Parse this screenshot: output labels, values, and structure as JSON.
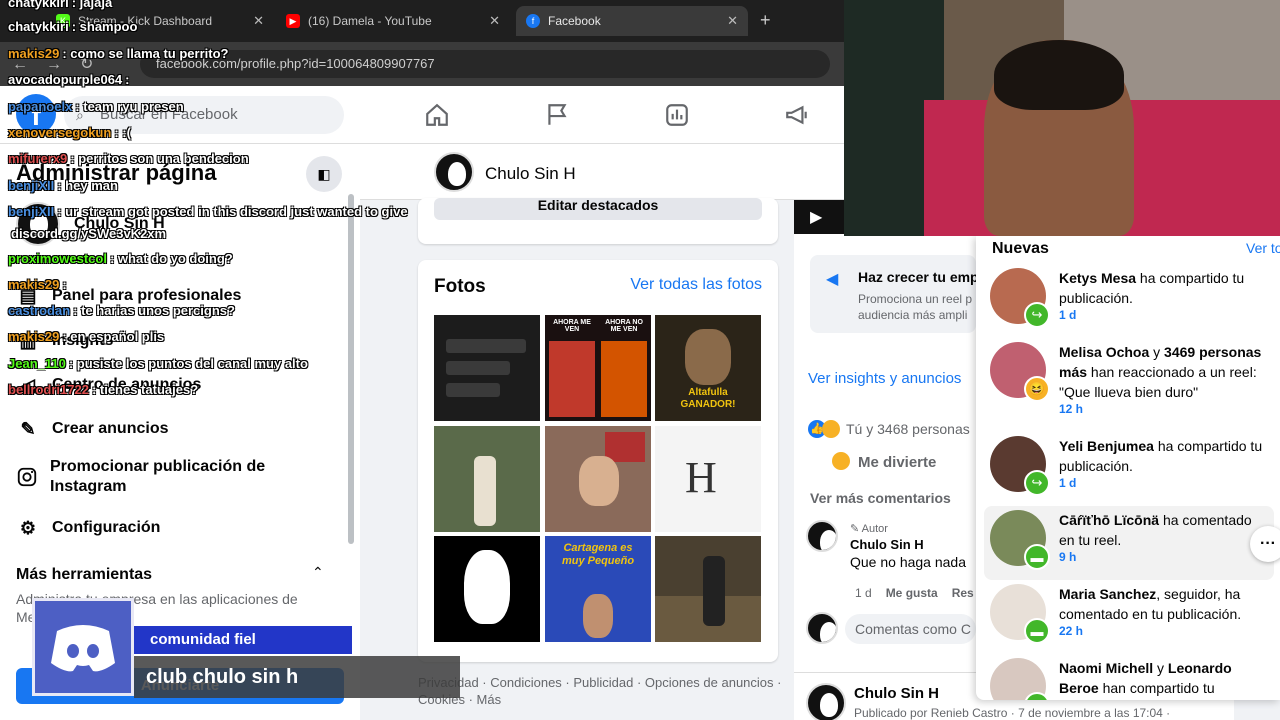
{
  "browser": {
    "tabs": [
      {
        "label": "Stream - Kick Dashboard",
        "color": "#53fc18"
      },
      {
        "label": "(16) Damela - YouTube",
        "color": "#ff0000"
      },
      {
        "label": "Facebook",
        "color": "#1877f2"
      }
    ],
    "url": "facebook.com/profile.php?id=100064809907767"
  },
  "fb_header": {
    "search_placeholder": "Buscar en Facebook",
    "nav_icons": [
      "home-icon",
      "flag-icon",
      "insights-icon",
      "megaphone-icon"
    ]
  },
  "sidebar": {
    "title": "Administrar página",
    "page_name": "Chulo Sin H",
    "items": [
      {
        "label": "Panel para profesionales",
        "icon": "dashboard-icon"
      },
      {
        "label": "Insights",
        "icon": "insights-icon"
      },
      {
        "label": "Centro de anuncios",
        "icon": "megaphone-icon"
      },
      {
        "label": "Crear anuncios",
        "icon": "pencil-icon"
      },
      {
        "label": "Promocionar publicación de Instagram",
        "icon": "instagram-icon"
      },
      {
        "label": "Configuración",
        "icon": "gear-icon"
      }
    ],
    "more_tools_title": "Más herramientas",
    "more_tools_desc": "Administra tu empresa en las aplicaciones de Meta.",
    "ad_button": "Anunciarte"
  },
  "main": {
    "page_name": "Chulo Sin H",
    "edit_featured": "Editar destacados",
    "photos_title": "Fotos",
    "photos_link": "Ver todas las fotos",
    "photo_captions": [
      "",
      "AHORA ME VEN",
      "AHORA NO ME VEN",
      "Altafulla GANADOR!",
      "",
      "",
      "H",
      "",
      "Cartagena es muy Pequeño",
      ""
    ],
    "footer": "Privacidad · Condiciones · Publicidad · Opciones de anuncios · Cookies · Más"
  },
  "right": {
    "grow_title": "Haz crecer tu emp",
    "grow_desc": "Promociona un reel p audiencia más ampli",
    "insights_link": "Ver insights y anuncios",
    "reactions": "Tú y 3468 personas",
    "reaction_label": "Me divierte",
    "more_comments": "Ver más comentarios",
    "comment": {
      "badge": "Autor",
      "name": "Chulo Sin H",
      "text": "Que no haga nada",
      "time": "1 d",
      "like": "Me gusta",
      "reply": "Res"
    },
    "comment_placeholder": "Comentas como C",
    "post2": {
      "name": "Chulo Sin H",
      "meta": "Publicado por Renieb Castro · 7 de noviembre a las 17:04 ·"
    }
  },
  "notifications": {
    "header": "Nuevas",
    "see_all": "Ver to",
    "items": [
      {
        "name": "Ketys Mesa",
        "text": " ha compartido tu publicación.",
        "time": "1 d",
        "badge": "share",
        "color": "#42b72a"
      },
      {
        "name": "Melisa Ochoa",
        "name2": "3469 personas más",
        "text": " han reaccionado a un reel: \"Que llueva bien duro\"",
        "time": "12 h",
        "badge": "haha",
        "color": "#f7b125"
      },
      {
        "name": "Yeli Benjumea",
        "text": " ha compartido tu publicación.",
        "time": "1 d",
        "badge": "share",
        "color": "#42b72a"
      },
      {
        "name": "Cāŕïťhō Lïcōnä",
        "text": " ha comentado en tu reel.",
        "time": "9 h",
        "badge": "comment",
        "color": "#42b72a"
      },
      {
        "name": "Maria Sanchez",
        "text": ", seguidor, ha comentado en tu publicación.",
        "time": "22 h",
        "badge": "comment",
        "color": "#42b72a"
      },
      {
        "name": "Naomi Michell",
        "name2": "Leonardo Beroe",
        "text": " han compartido tu",
        "time": "",
        "badge": "share",
        "color": "#42b72a"
      }
    ],
    "and_word": "y"
  },
  "chat": [
    {
      "user": "chatykkiri",
      "text": ": jajaja",
      "color": "#ffffff"
    },
    {
      "user": "chatykkiri",
      "text": ": shampoo",
      "color": "#ffffff"
    },
    {
      "user": "makis29",
      "text": ": como se llama tu perrito?",
      "color": "#f0a020"
    },
    {
      "user": "avocadopurple064",
      "text": ":",
      "color": "#ffffff"
    },
    {
      "user": "papanoelx",
      "text": ": team ryu presen",
      "color": "#4a90e2"
    },
    {
      "user": "xenoversegokun",
      "text": ": :(",
      "color": "#f0a020"
    },
    {
      "user": "mifurerx9",
      "text": ": perritos son una bendecion",
      "color": "#e05050"
    },
    {
      "user": "benjiXII",
      "text": ": hey man",
      "color": "#4a90e2"
    },
    {
      "user": "benjiXII",
      "text": ": ur stream got posted in this discord just wanted to give",
      "color": "#4a90e2"
    },
    {
      "user": "",
      "text": "discord.gg/ySWe3vK2xm",
      "color": "#ffffff"
    },
    {
      "user": "proximowestcol",
      "text": ": what do yo doing?",
      "color": "#53fc18"
    },
    {
      "user": "makis29",
      "text": ":",
      "color": "#f0a020"
    },
    {
      "user": "castrodan",
      "text": ": te harias unos percigns?",
      "color": "#4a90e2"
    },
    {
      "user": "makis29",
      "text": ": en español plis",
      "color": "#f0a020"
    },
    {
      "user": "Jean_110",
      "text": ": pusiste los puntos del canal muy alto",
      "color": "#53fc18"
    },
    {
      "user": "bellrodri1722",
      "text": ": tienes tatuajes?",
      "color": "#e05050"
    }
  ],
  "discord": {
    "label1": "comunidad fiel",
    "label2": "club chulo sin h"
  }
}
